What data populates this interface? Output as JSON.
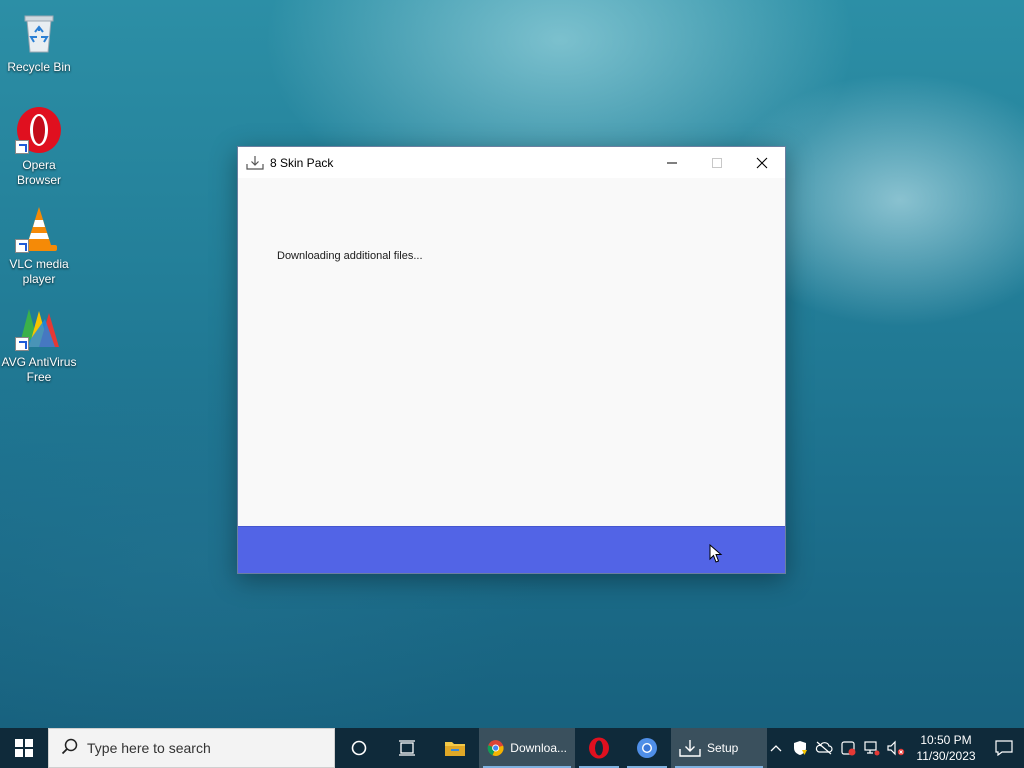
{
  "desktop": {
    "icons": [
      {
        "label": "Recycle Bin"
      },
      {
        "label": "Opera Browser"
      },
      {
        "label": "VLC media player"
      },
      {
        "label": "AVG AntiVirus Free"
      }
    ]
  },
  "window": {
    "title": "8 Skin Pack",
    "status_text": "Downloading additional files...",
    "footer_color": "#5264e6"
  },
  "taskbar": {
    "search_placeholder": "Type here to search",
    "apps": [
      {
        "label": "Downloa..."
      },
      {
        "label": "Setup"
      }
    ],
    "clock_time": "10:50 PM",
    "clock_date": "11/30/2023"
  }
}
